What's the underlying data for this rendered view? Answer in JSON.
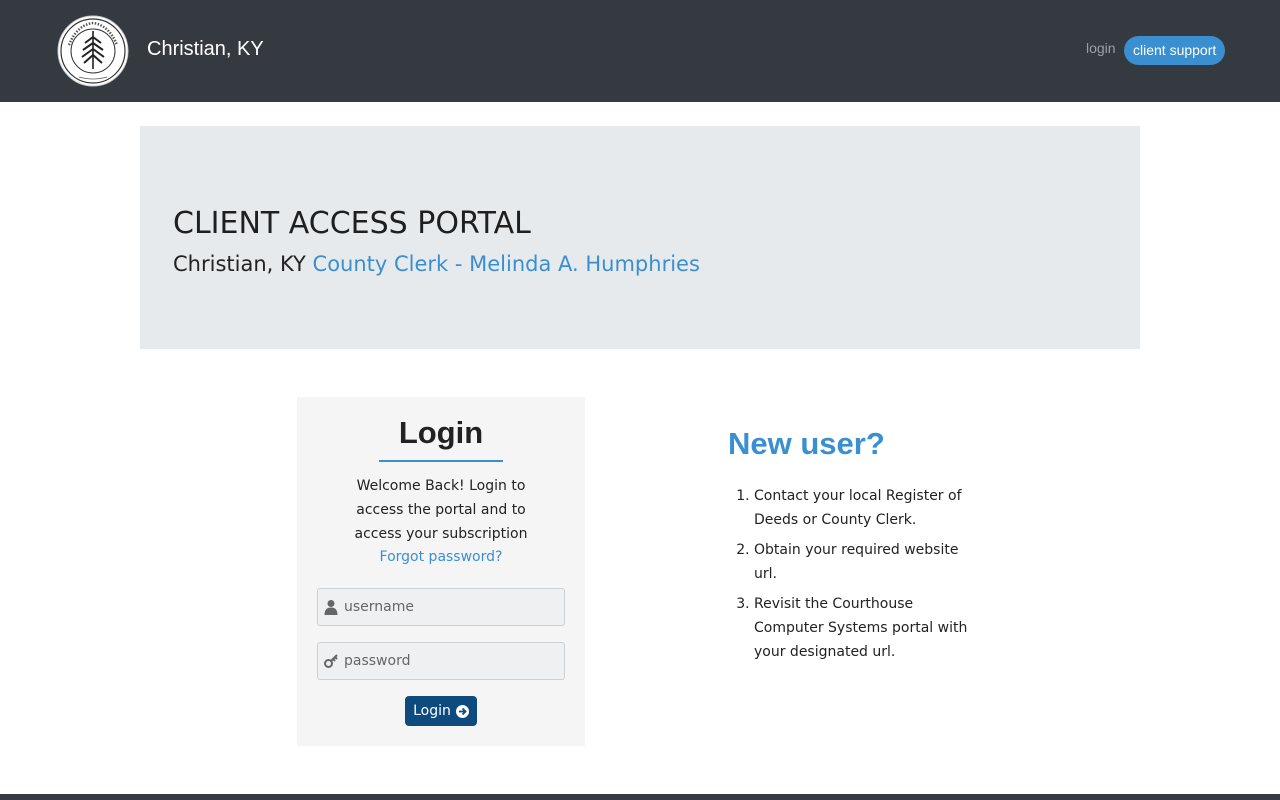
{
  "header": {
    "brand": "Christian, KY",
    "nav_login": "login",
    "nav_support": "client support",
    "seal_text": "CHRISTIAN COUNTY, KENTUCKY 1797"
  },
  "hero": {
    "title": "CLIENT ACCESS PORTAL",
    "subtitle_prefix": "Christian, KY",
    "subtitle_link": "County Clerk - Melinda A. Humphries"
  },
  "login": {
    "heading": "Login",
    "welcome": "Welcome Back! Login to access the portal and to access your subscription",
    "forgot": "Forgot password?",
    "username_placeholder": "username",
    "password_placeholder": "password",
    "button_label": "Login"
  },
  "new_user": {
    "heading": "New user?",
    "steps": [
      "Contact your local Register of Deeds or County Clerk.",
      "Obtain your required website url.",
      "Revisit the Courthouse Computer Systems portal with your designated url."
    ]
  },
  "colors": {
    "topbar": "#343a40",
    "accent": "#3a8fd0",
    "login_button": "#0f4a7f",
    "hero_bg": "#e7eaed",
    "card_bg": "#f5f5f5"
  }
}
